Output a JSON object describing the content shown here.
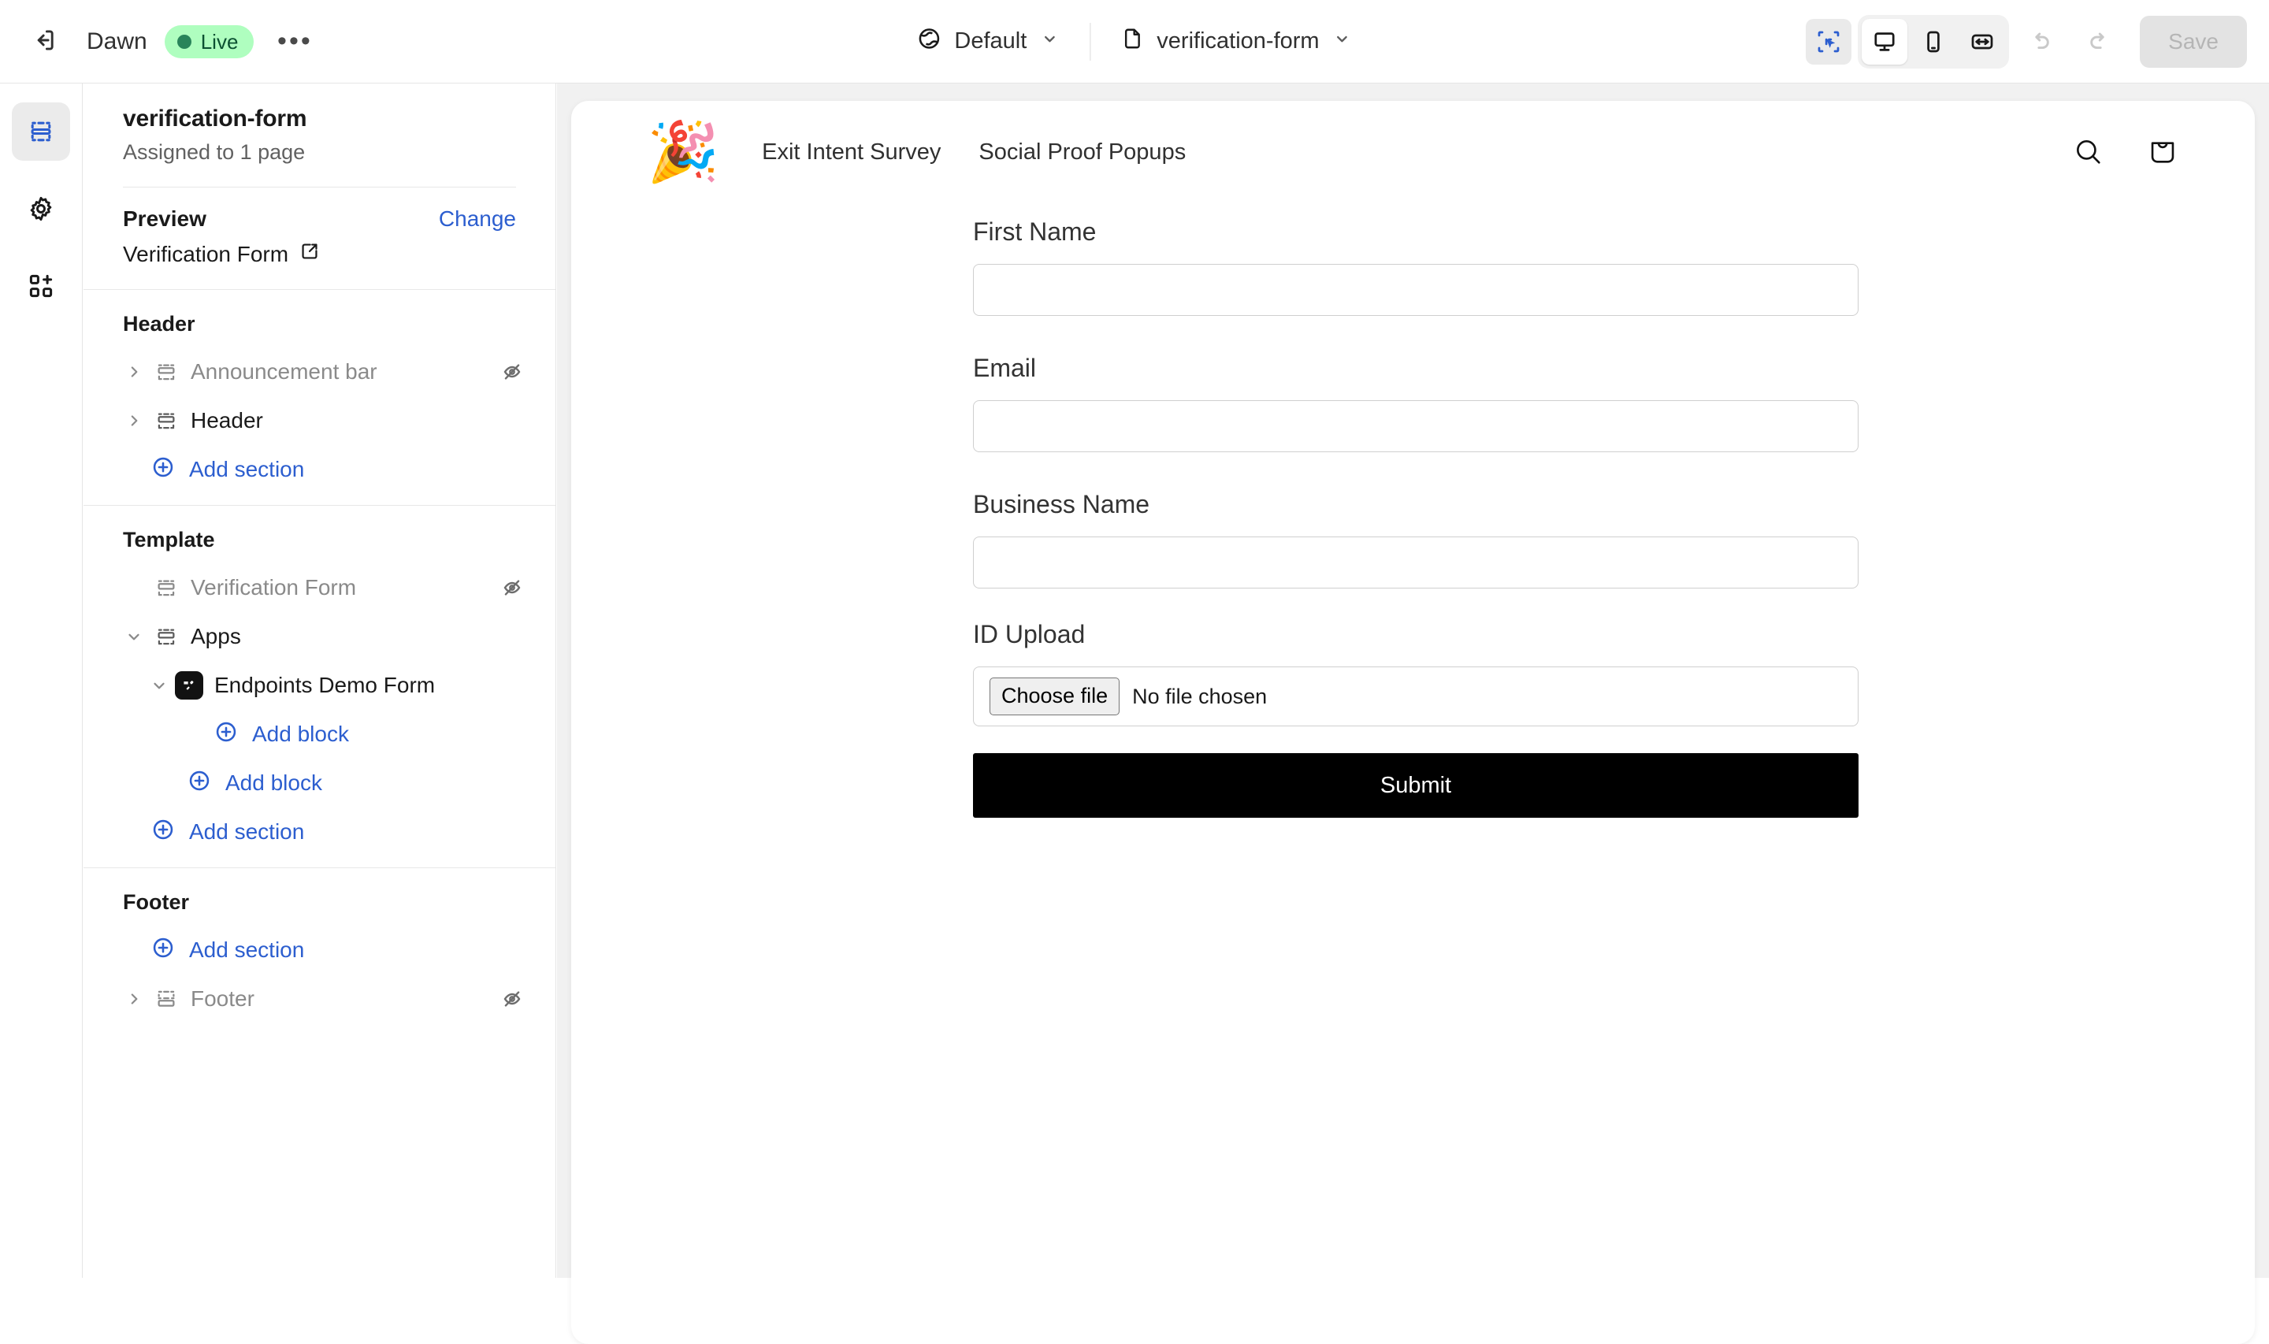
{
  "topbar": {
    "exit_icon": "exit-icon",
    "theme_name": "Dawn",
    "status_badge": "Live",
    "more_label": "•••",
    "theme_selector": {
      "icon": "globe-icon",
      "label": "Default",
      "chevron": "chevron-down-icon"
    },
    "page_selector": {
      "icon": "page-icon",
      "label": "verification-form",
      "chevron": "chevron-down-icon"
    },
    "view_modes": [
      {
        "name": "select-mode",
        "icon": "cursor-select-icon",
        "active": false
      },
      {
        "name": "desktop-view",
        "icon": "desktop-icon",
        "active": true
      },
      {
        "name": "mobile-view",
        "icon": "mobile-icon",
        "active": false
      },
      {
        "name": "fullscreen-view",
        "icon": "fullwidth-icon",
        "active": false
      }
    ],
    "undo_icon": "undo-icon",
    "redo_icon": "redo-icon",
    "save_label": "Save"
  },
  "rail": {
    "items": [
      {
        "name": "sections-rail-icon",
        "icon": "sections-icon",
        "active": true
      },
      {
        "name": "settings-rail-icon",
        "icon": "gear-icon",
        "active": false
      },
      {
        "name": "apps-rail-icon",
        "icon": "apps-grid-add-icon",
        "active": false
      }
    ]
  },
  "sidebar": {
    "title": "verification-form",
    "subtitle": "Assigned to 1 page",
    "preview": {
      "label": "Preview",
      "change_label": "Change",
      "value": "Verification Form",
      "external_icon": "external-link-icon"
    },
    "groups": [
      {
        "title": "Header",
        "rows": [
          {
            "label": "Announcement bar",
            "chevron": true,
            "icon": "section-icon",
            "hidden": true,
            "muted": true,
            "indent": 0
          },
          {
            "label": "Header",
            "chevron": true,
            "icon": "section-icon",
            "hidden": false,
            "muted": false,
            "indent": 0
          }
        ],
        "adds": [
          {
            "label": "Add section",
            "indent": 0
          }
        ]
      },
      {
        "title": "Template",
        "rows": [
          {
            "label": "Verification Form",
            "chevron": false,
            "icon": "section-icon",
            "hidden": true,
            "muted": true,
            "indent": 0
          },
          {
            "label": "Apps",
            "chevron": true,
            "expanded": true,
            "icon": "section-icon",
            "hidden": false,
            "muted": false,
            "indent": 0
          },
          {
            "label": "Endpoints Demo Form",
            "chevron": true,
            "expanded": true,
            "icon": "app-block-icon",
            "hidden": false,
            "muted": false,
            "indent": 1
          }
        ],
        "adds": [
          {
            "label": "Add block",
            "indent": 2
          },
          {
            "label": "Add block",
            "indent": 1
          },
          {
            "label": "Add section",
            "indent": 0
          }
        ]
      },
      {
        "title": "Footer",
        "rows": [],
        "adds": [
          {
            "label": "Add section",
            "indent": 0
          }
        ],
        "rows_after": [
          {
            "label": "Footer",
            "chevron": true,
            "icon": "footer-section-icon",
            "hidden": true,
            "muted": true,
            "indent": 0
          }
        ]
      }
    ]
  },
  "preview": {
    "store_logo": "🎉",
    "nav": [
      {
        "label": "Exit Intent Survey"
      },
      {
        "label": "Social Proof Popups"
      }
    ],
    "actions": [
      {
        "name": "search-icon"
      },
      {
        "name": "cart-icon"
      }
    ],
    "form": {
      "fields": [
        {
          "label": "First Name",
          "value": "",
          "type": "text"
        },
        {
          "label": "Email",
          "value": "",
          "type": "text"
        },
        {
          "label": "Business Name",
          "value": "",
          "type": "text"
        }
      ],
      "upload": {
        "label": "ID Upload",
        "button_label": "Choose file",
        "status_text": "No file chosen"
      },
      "submit_label": "Submit"
    }
  },
  "colors": {
    "accent_blue": "#2c5ecf",
    "live_bg": "#affebf",
    "live_fg": "#0c5132",
    "submit_bg": "#000000",
    "stage_bg": "#f1f1f1"
  }
}
